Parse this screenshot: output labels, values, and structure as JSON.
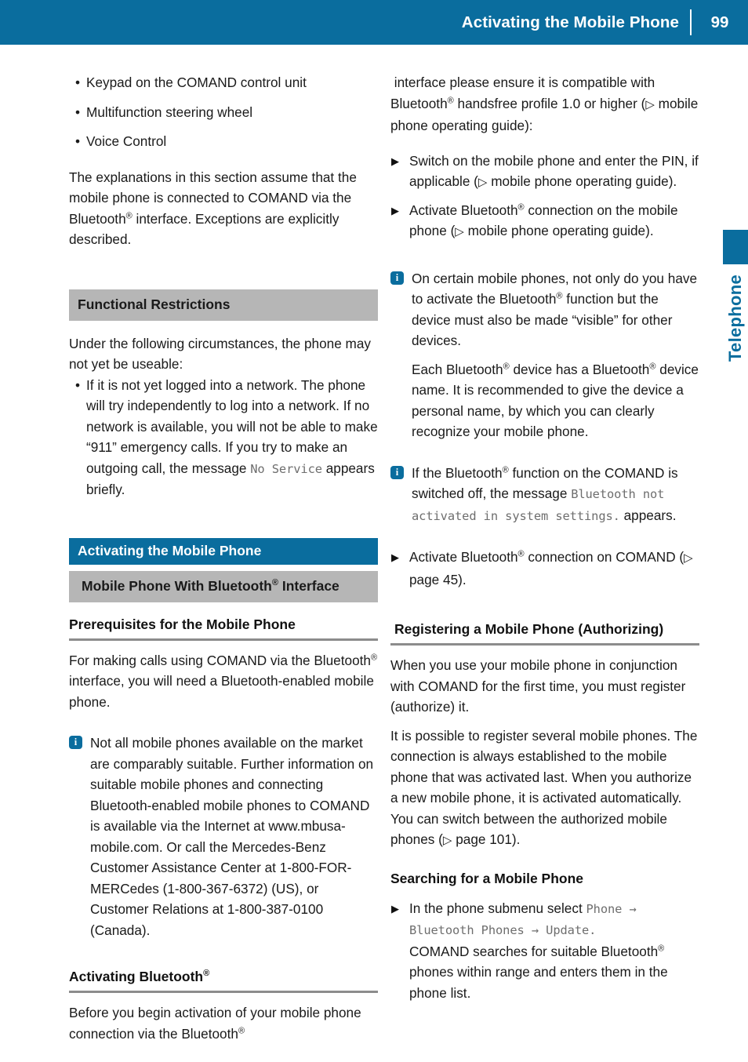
{
  "header": {
    "title": "Activating the Mobile Phone",
    "page_number": "99"
  },
  "side_tab": {
    "label": "Telephone"
  },
  "left_column": {
    "input_methods": [
      "Keypad on the COMAND control unit",
      "Multifunction steering wheel",
      "Voice Control"
    ],
    "intro_paragraph": "The explanations in this section assume that the mobile phone is connected to COMAND via the Bluetooth® interface. Exceptions are explicitly described.",
    "functional_restrictions_heading": "Functional Restrictions",
    "restrictions_intro": "Under the following circumstances, the phone may not yet be useable:",
    "restriction_bullet_part1": "If it is not yet logged into a network. The phone will try independently to log into a network. If no network is available, you will not be able to make “911” emergency calls. If you try to make an outgoing call, the message ",
    "restriction_bullet_mono": "No Service",
    "restriction_bullet_part2": " appears briefly.",
    "activating_heading": "Activating the Mobile Phone",
    "mobile_phone_bt_heading": "Mobile Phone With Bluetooth® Interface",
    "prerequisites_heading": "Prerequisites for the Mobile Phone",
    "prerequisites_paragraph": "For making calls using COMAND via the Bluetooth® interface, you will need a Bluetooth-enabled mobile phone.",
    "note_suitability": "Not all mobile phones available on the market are comparably suitable. Further information on suitable mobile phones and connecting Bluetooth-enabled mobile phones to COMAND is available via the Internet at www.mbusa-mobile.com. Or call the Mercedes-Benz Customer Assistance Center at 1-800-FOR-MERCedes (1-800-367-6372) (US), or Customer Relations at 1-800-387-0100 (Canada).",
    "activating_bluetooth_heading": "Activating Bluetooth®",
    "activating_bluetooth_paragraph": "Before you begin activation of your mobile phone connection via the Bluetooth®"
  },
  "right_column": {
    "continuation_paragraph": "interface please ensure it is compatible with Bluetooth® handsfree profile 1.0 or higher (▷ mobile phone operating guide):",
    "steps_1": [
      "Switch on the mobile phone and enter the PIN, if applicable (▷ mobile phone operating guide).",
      "Activate Bluetooth® connection on the mobile phone (▷ mobile phone operating guide)."
    ],
    "note_visible": "On certain mobile phones, not only do you have to activate the Bluetooth® function but the device must also be made “visible” for other devices.",
    "note_visible_cont": "Each Bluetooth® device has a Bluetooth® device name. It is recommended to give the device a personal name, by which you can clearly recognize your mobile phone.",
    "note_switched_off_part1": "If the Bluetooth® function on the COMAND is switched off, the message ",
    "note_switched_off_mono": "Bluetooth not activated in system settings.",
    "note_switched_off_part2": " appears.",
    "step_activate_comand": "Activate Bluetooth® connection on COMAND (▷ page 45).",
    "registering_heading": "Registering a Mobile Phone (Authorizing)",
    "registering_paragraph_1": "When you use your mobile phone in conjunction with COMAND for the first time, you must register (authorize) it.",
    "registering_paragraph_2": "It is possible to register several mobile phones. The connection is always established to the mobile phone that was activated last. When you authorize a new mobile phone, it is activated automatically. You can switch between the authorized mobile phones (▷ page 101).",
    "searching_heading": "Searching for a Mobile Phone",
    "search_step_part1": "In the phone submenu select ",
    "search_step_mono": "Phone → Bluetooth Phones → Update.",
    "search_step_part2": "COMAND searches for suitable Bluetooth® phones within range and enters them in the phone list."
  },
  "colors": {
    "brand_blue": "#0a6d9e",
    "band_gray": "#b6b6b6",
    "rule_gray": "#8c8c8c",
    "mono_gray": "#6e6e6e"
  },
  "icons": {
    "info": "i",
    "step_marker": "▶",
    "cross_reference": "▷",
    "bullet": "•"
  }
}
